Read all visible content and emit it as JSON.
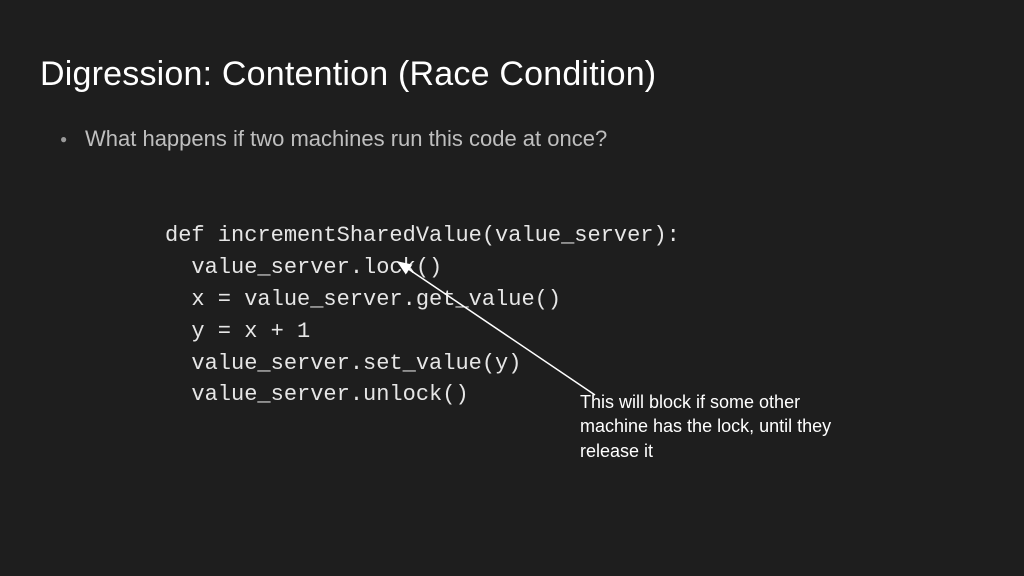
{
  "title": "Digression: Contention (Race Condition)",
  "bullet": "What happens if two machines run this code at once?",
  "code": {
    "line1": "def incrementSharedValue(value_server):",
    "line2": "  value_server.lock()",
    "line3": "  x = value_server.get_value()",
    "line4": "  y = x + 1",
    "line5": "  value_server.set_value(y)",
    "line6": "  value_server.unlock()"
  },
  "annotation": "This will block if some other machine has the lock, until they release it"
}
